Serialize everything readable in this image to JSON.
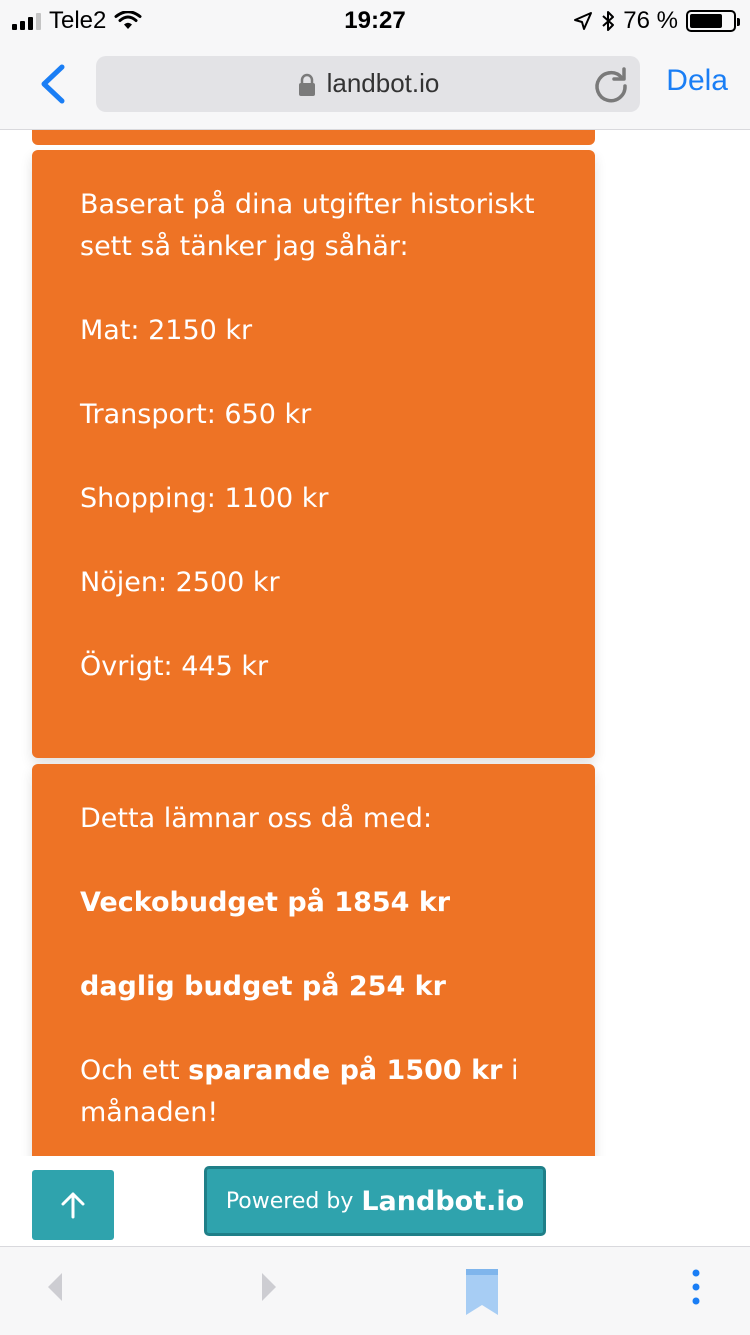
{
  "status": {
    "carrier": "Tele2",
    "time": "19:27",
    "battery_text": "76 %",
    "battery_level": 0.76
  },
  "browser": {
    "url": "landbot.io",
    "share_label": "Dela"
  },
  "chat": {
    "bubble1": {
      "intro": "Baserat på dina utgifter historiskt sett så tänker jag såhär:",
      "items": [
        "Mat: 2150 kr",
        "Transport: 650 kr",
        "Shopping: 1100 kr",
        "Nöjen: 2500 kr",
        "Övrigt: 445 kr"
      ]
    },
    "bubble2": {
      "intro": "Detta lämnar oss då med:",
      "weekly": "Veckobudget på 1854 kr",
      "daily": "daglig budget på 254 kr",
      "savings_prefix": "Och ett ",
      "savings_bold": "sparande på 1500 kr",
      "savings_suffix": " i månaden!"
    }
  },
  "widget": {
    "powered_label": "Powered by",
    "powered_brand": "Landbot.io"
  },
  "colors": {
    "bubble": "#ee7325",
    "accent": "#2fa3ad",
    "ios_blue": "#1a7ef5"
  },
  "icons": [
    "signal-icon",
    "wifi-icon",
    "location-icon",
    "bluetooth-icon",
    "battery-icon",
    "back-chevron-icon",
    "lock-icon",
    "reload-icon",
    "arrow-up-icon",
    "back-arrow-icon",
    "forward-arrow-icon",
    "bookmarks-icon",
    "more-icon"
  ]
}
